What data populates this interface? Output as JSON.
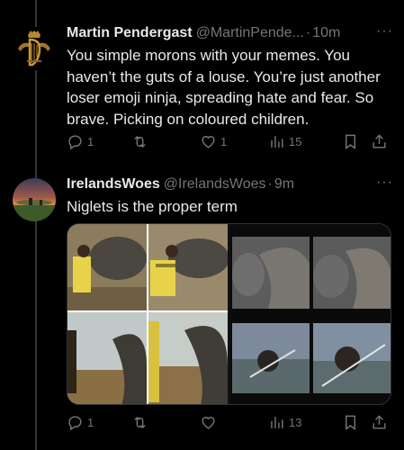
{
  "tweets": [
    {
      "name": "Martin Pendergast",
      "handle": "@MartinPende...",
      "time": "10m",
      "text": "You simple morons with your memes. You haven’t the guts of a louse. You’re just another loser emoji ninja, spreading hate and fear. So brave. Picking on coloured children.",
      "replies": "1",
      "retweets": "",
      "likes": "1",
      "views": "15",
      "avatar_icon": "harp-crest-icon"
    },
    {
      "name": "IrelandsWoes",
      "handle": "@IrelandsWoes",
      "time": "9m",
      "text": "Niglets is the proper term",
      "replies": "1",
      "retweets": "",
      "likes": "",
      "views": "13",
      "avatar_icon": "sunset-landscape-avatar"
    }
  ],
  "ui": {
    "dot": "·",
    "more": "···"
  },
  "colors": {
    "background": "#000000",
    "text": "#e7e9ea",
    "muted": "#71767b",
    "divider": "#2f3336"
  }
}
